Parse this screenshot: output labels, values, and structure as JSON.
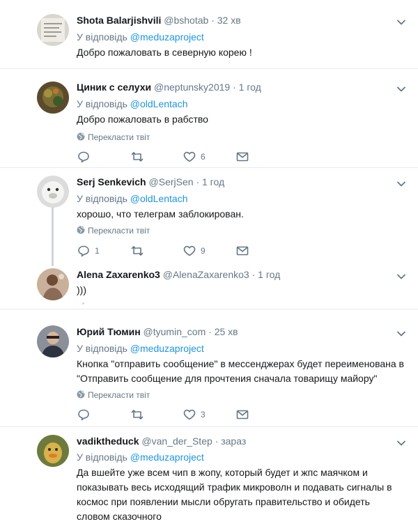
{
  "common": {
    "reply_to_label": "У відповідь",
    "translate_label": "Перекласти твіт",
    "dot": "·"
  },
  "tweets": [
    {
      "name": "Shota Balarjishvili",
      "handle": "@bshotab",
      "time": "32 хв",
      "reply_to": "@meduzaproject",
      "text": "Добро пожаловать в северную корею !"
    },
    {
      "name": "Циник с селухи",
      "handle": "@neptunsky2019",
      "time": "1 год",
      "reply_to": "@oldLentach",
      "text": "Добро пожаловать в рабство",
      "likes": "6"
    },
    {
      "name": "Serj Senkevich",
      "handle": "@SerjSen",
      "time": "1 год",
      "reply_to": "@oldLentach",
      "text": "хорошо, что телеграм заблокирован.",
      "replies": "1",
      "likes": "9"
    },
    {
      "name": "Alena Zaxarenko3",
      "handle": "@AlenaZaxarenko3",
      "time": "1 год",
      "text": ")))"
    },
    {
      "name": "Юрий Тюмин",
      "handle": "@tyumin_com",
      "time": "25 хв",
      "reply_to": "@meduzaproject",
      "text": "Кнопка \"отправить сообщение\" в мессенджерах будет переименована в \"Отправить сообщение для прочтения сначала товарищу майору\"",
      "likes": "3"
    },
    {
      "name": "vadiktheduck",
      "handle": "@van_der_Step",
      "time": "зараз",
      "reply_to": "@meduzaproject",
      "text": "Да вшейте уже всем чип в жопу, который будет и жпс маячком и показывать весь исходящий трафик микроволн и подавать сигналы в космос при появлении мысли обругать правительство и обидеть словом сказочного"
    }
  ],
  "icons": {
    "reply": "reply-icon",
    "retweet": "retweet-icon",
    "like": "heart-icon",
    "dm": "envelope-icon",
    "caret": "chevron-down-icon",
    "globe": "globe-icon"
  },
  "colors": {
    "link": "#1b95e0",
    "muted": "#657786",
    "text": "#14171a",
    "divider": "#e6ecf0",
    "thread_line": "#ccd6dd"
  }
}
